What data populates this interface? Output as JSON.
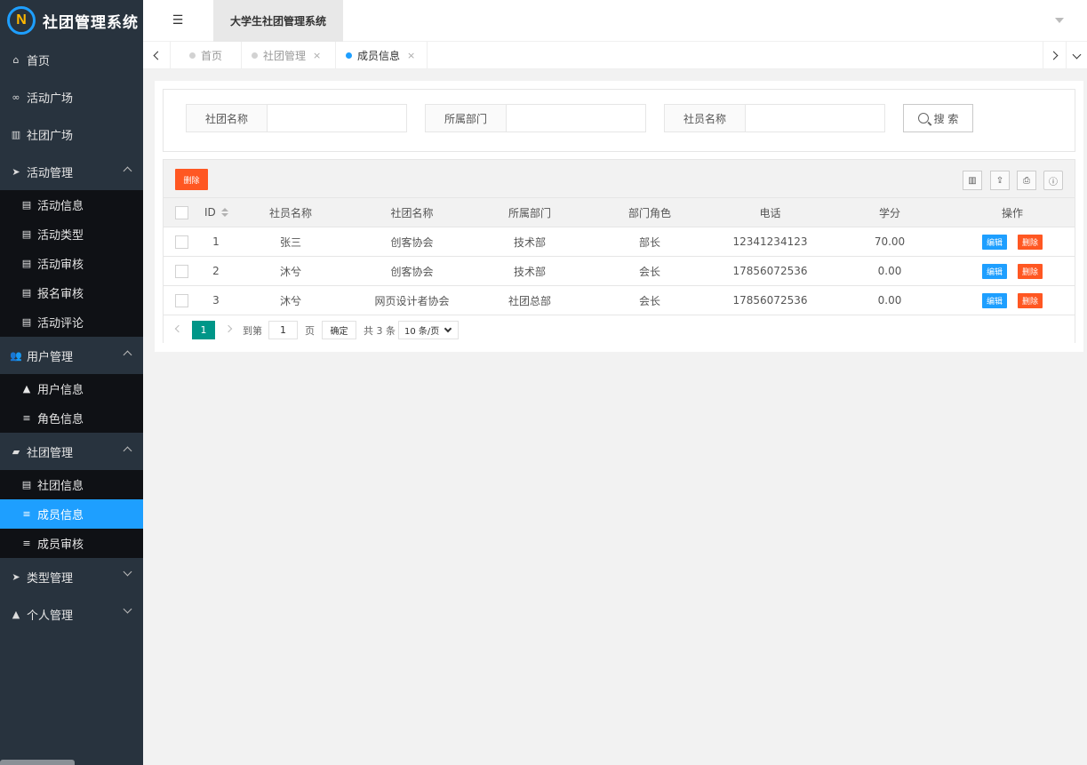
{
  "app": {
    "logo_letter": "N",
    "title": "社团管理系统",
    "header_tab": "大学生社团管理系统",
    "colors": {
      "sidebar_bg": "#28333e",
      "accent": "#1e9fff",
      "danger": "#ff5722",
      "pager_active": "#009688"
    }
  },
  "sidebar": {
    "items": [
      {
        "label": "首页",
        "icon": "home-icon"
      },
      {
        "label": "活动广场",
        "icon": "bicycle-icon"
      },
      {
        "label": "社团广场",
        "icon": "bank-icon"
      },
      {
        "label": "活动管理",
        "icon": "paper-plane-icon",
        "expanded": true,
        "children": [
          "活动信息",
          "活动类型",
          "活动审核",
          "报名审核",
          "活动评论"
        ]
      },
      {
        "label": "用户管理",
        "icon": "users-icon",
        "expanded": true,
        "children": [
          "用户信息",
          "角色信息"
        ]
      },
      {
        "label": "社团管理",
        "icon": "book-icon",
        "expanded": true,
        "children": [
          "社团信息",
          "成员信息",
          "成员审核"
        ],
        "active_child": "成员信息"
      },
      {
        "label": "类型管理",
        "icon": "paper-plane-icon",
        "expanded": false
      },
      {
        "label": "个人管理",
        "icon": "user-icon",
        "expanded": false
      }
    ]
  },
  "tabs": [
    {
      "label": "首页",
      "closable": false,
      "active": false
    },
    {
      "label": "社团管理",
      "closable": true,
      "active": false
    },
    {
      "label": "成员信息",
      "closable": true,
      "active": true
    }
  ],
  "tab_close_glyph": "×",
  "search": {
    "fields": [
      {
        "label": "社团名称",
        "value": ""
      },
      {
        "label": "所属部门",
        "value": ""
      },
      {
        "label": "社员名称",
        "value": ""
      }
    ],
    "button_label": "搜 索"
  },
  "toolbar": {
    "delete_label": "删除",
    "icons": [
      "columns-icon",
      "export-icon",
      "print-icon",
      "info-icon"
    ]
  },
  "table": {
    "columns": [
      "ID",
      "社员名称",
      "社团名称",
      "所属部门",
      "部门角色",
      "电话",
      "学分",
      "操作"
    ],
    "rows": [
      {
        "id": "1",
        "member": "张三",
        "club": "创客协会",
        "dept": "技术部",
        "role": "部长",
        "phone": "12341234123",
        "credit": "70.00"
      },
      {
        "id": "2",
        "member": "沐兮",
        "club": "创客协会",
        "dept": "技术部",
        "role": "会长",
        "phone": "17856072536",
        "credit": "0.00"
      },
      {
        "id": "3",
        "member": "沐兮",
        "club": "网页设计者协会",
        "dept": "社团总部",
        "role": "会长",
        "phone": "17856072536",
        "credit": "0.00"
      }
    ],
    "edit_label": "编辑",
    "delete_label": "删除"
  },
  "pager": {
    "current": "1",
    "goto_label": "到第",
    "goto_value": "1",
    "page_label": "页",
    "confirm_label": "确定",
    "total_label": "共 3 条",
    "page_size": "10 条/页"
  }
}
